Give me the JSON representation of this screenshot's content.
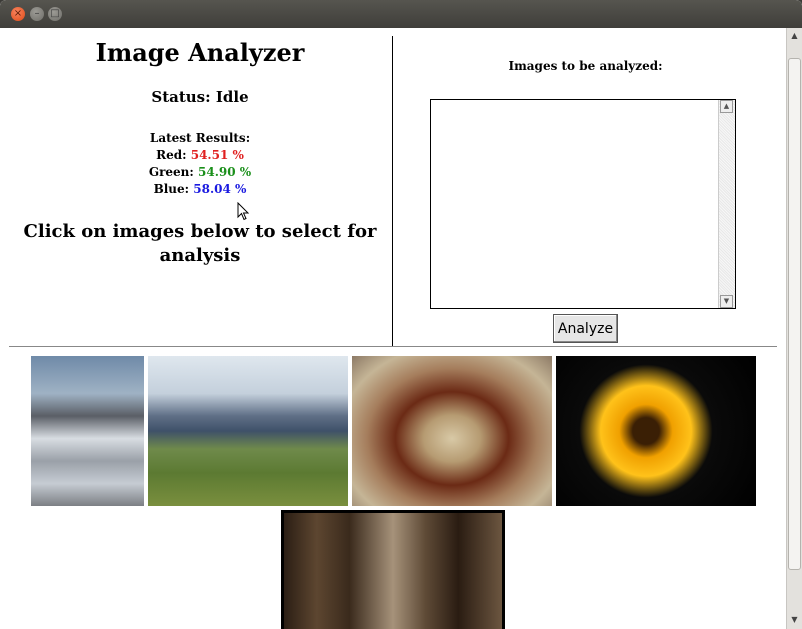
{
  "window": {
    "close_glyph": "×",
    "min_glyph": "–",
    "max_glyph": "□"
  },
  "app": {
    "title": "Image Analyzer",
    "status": "Status: Idle",
    "results_label": "Latest Results:",
    "red_label": "Red:",
    "red_value": "54.51 %",
    "green_label": "Green:",
    "green_value": "54.90 %",
    "blue_label": "Blue:",
    "blue_value": "58.04 %",
    "instruction": "Click on images below to select for analysis"
  },
  "queue": {
    "title": "Images to be analyzed:",
    "items": [],
    "analyze_label": "Analyze"
  },
  "images": [
    {
      "name": "mountain-snow-image"
    },
    {
      "name": "alpine-cabin-image"
    },
    {
      "name": "shell-on-pebbles-image"
    },
    {
      "name": "sunflower-image"
    },
    {
      "name": "misty-forest-image",
      "selected": true
    }
  ],
  "colors": {
    "red": "#e02020",
    "green": "#1a8f1a",
    "blue": "#1a1ae0"
  }
}
